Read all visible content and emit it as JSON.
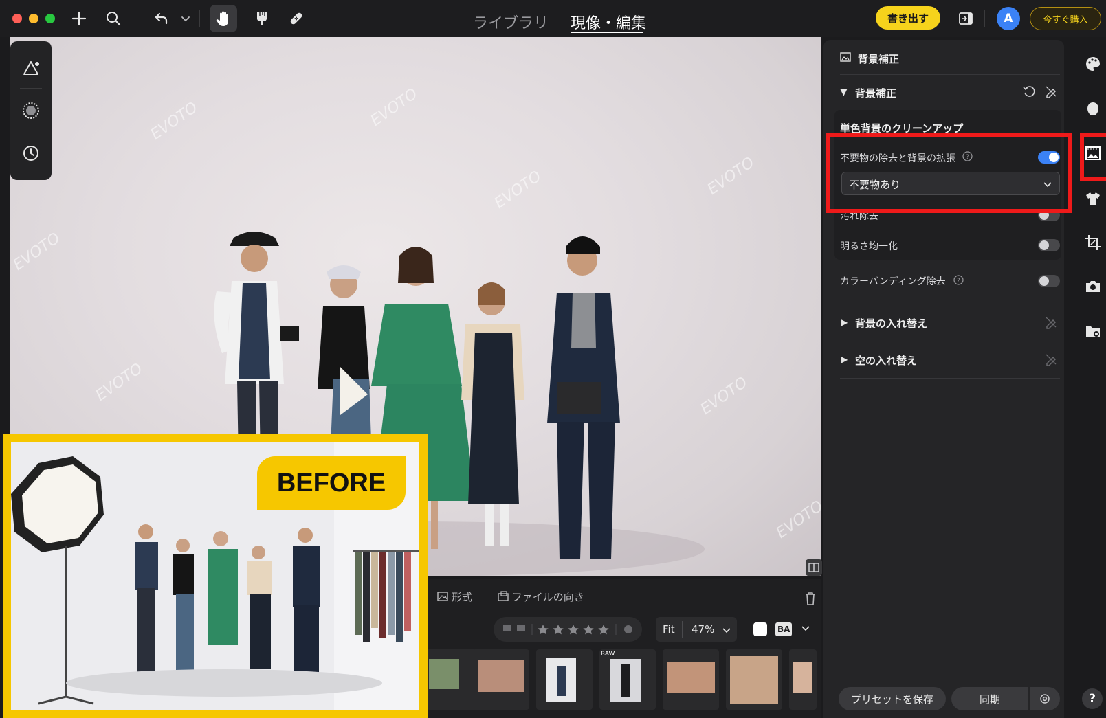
{
  "topbar": {
    "nav_library": "ライブラリ",
    "nav_develop": "現像・編集",
    "export_label": "書き出す",
    "avatar_letter": "A",
    "buy_label": "今すぐ購入"
  },
  "watermark": "EVOTO",
  "filmstrip": {
    "format_label": "形式",
    "orientation_label": "ファイルの向き",
    "zoom_fit": "Fit",
    "zoom_value": "47%",
    "view_mode": "BA",
    "raw_badge": "RAW"
  },
  "panel": {
    "header_title": "背景補正",
    "section_title": "背景補正",
    "card_title": "単色背景のクリーンアップ",
    "remove_label": "不要物の除去と背景の拡張",
    "dropdown_value": "不要物あり",
    "stain_label": "汚れ除去",
    "brightness_label": "明るさ均一化",
    "banding_label": "カラーバンディング除去",
    "replace_bg_label": "背景の入れ替え",
    "replace_sky_label": "空の入れ替え",
    "save_preset_label": "プリセットを保存",
    "sync_label": "同期"
  },
  "toggles": {
    "remove": true,
    "stain": false,
    "brightness": false,
    "banding": false
  },
  "before_badge": "BEFORE",
  "help_label": "?",
  "colors": {
    "accent_yellow": "#f6d31c",
    "toggle_blue": "#3b82f6",
    "highlight_red": "#ef1a1a",
    "before_border": "#f6c700"
  }
}
